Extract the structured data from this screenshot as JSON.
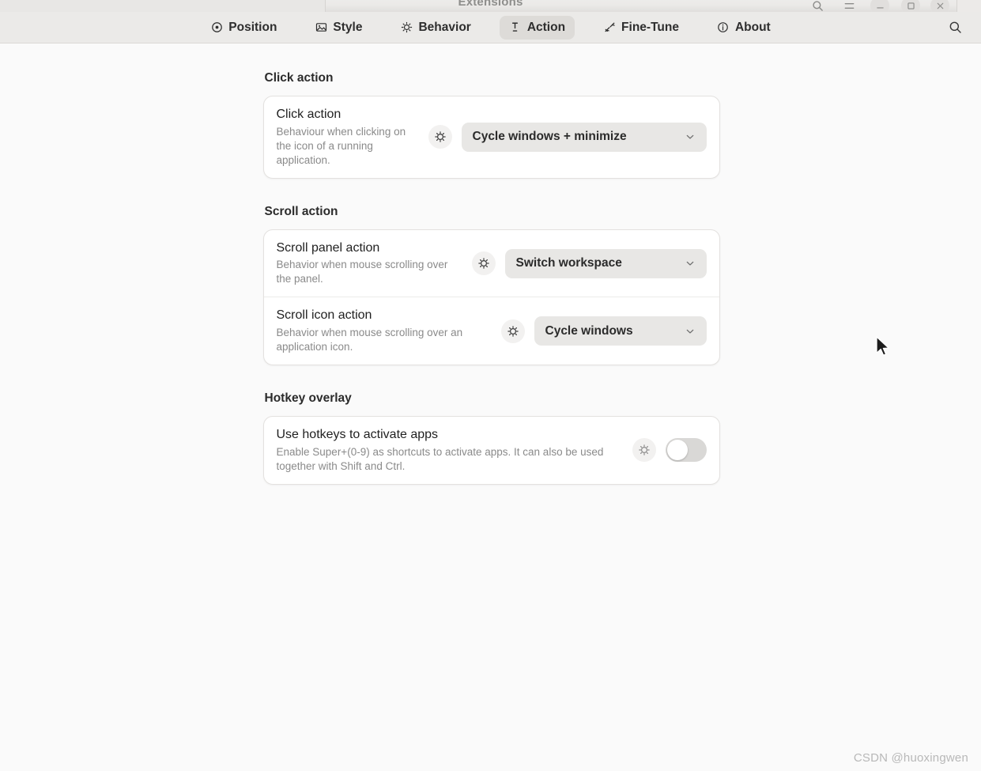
{
  "window": {
    "title": "Extensions",
    "controls": [
      {
        "name": "search-icon",
        "label": "Search"
      },
      {
        "name": "menu-icon",
        "label": "Main Menu"
      },
      {
        "name": "minimize-icon",
        "label": "Minimize"
      },
      {
        "name": "maximize-icon",
        "label": "Maximize"
      },
      {
        "name": "close-icon",
        "label": "Close"
      }
    ]
  },
  "tabs": [
    {
      "label": "Position",
      "icon": "target-icon",
      "active": false
    },
    {
      "label": "Style",
      "icon": "image-icon",
      "active": false
    },
    {
      "label": "Behavior",
      "icon": "gear-icon",
      "active": false
    },
    {
      "label": "Action",
      "icon": "pin-icon",
      "active": true
    },
    {
      "label": "Fine-Tune",
      "icon": "wrench-icon",
      "active": false
    },
    {
      "label": "About",
      "icon": "info-icon",
      "active": false
    }
  ],
  "tabbar": {
    "search_icon": "search-icon"
  },
  "groups": [
    {
      "title": "Click action",
      "rows": [
        {
          "title": "Click action",
          "subtitle": "Behaviour when clicking on the icon of a running application.",
          "control": "dropdown",
          "value": "Cycle windows + minimize",
          "reset_icon": "reset-gear-icon"
        }
      ]
    },
    {
      "title": "Scroll action",
      "rows": [
        {
          "title": "Scroll panel action",
          "subtitle": "Behavior when mouse scrolling over the panel.",
          "control": "dropdown",
          "value": "Switch workspace",
          "reset_icon": "reset-gear-icon"
        },
        {
          "title": "Scroll icon action",
          "subtitle": "Behavior when mouse scrolling over an application icon.",
          "control": "dropdown",
          "value": "Cycle windows",
          "reset_icon": "reset-gear-icon"
        }
      ]
    },
    {
      "title": "Hotkey overlay",
      "rows": [
        {
          "title": "Use hotkeys to activate apps",
          "subtitle": "Enable Super+(0-9) as shortcuts to activate apps. It can also be used together with Shift and Ctrl.",
          "control": "toggle",
          "value": "off",
          "reset_icon": "reset-gear-icon"
        }
      ]
    }
  ],
  "watermark": "CSDN @huoxingwen",
  "colors": {
    "page_background": "#fafafa",
    "card_background": "#ffffff",
    "tabbar_background": "#ebeae8",
    "dropdown_background": "#e8e7e5",
    "active_tab_background": "#dddbd8",
    "toggle_off_track": "#d9d8d6",
    "subtitle_text": "#8a8a8a",
    "title_text": "#1f1f1f"
  }
}
